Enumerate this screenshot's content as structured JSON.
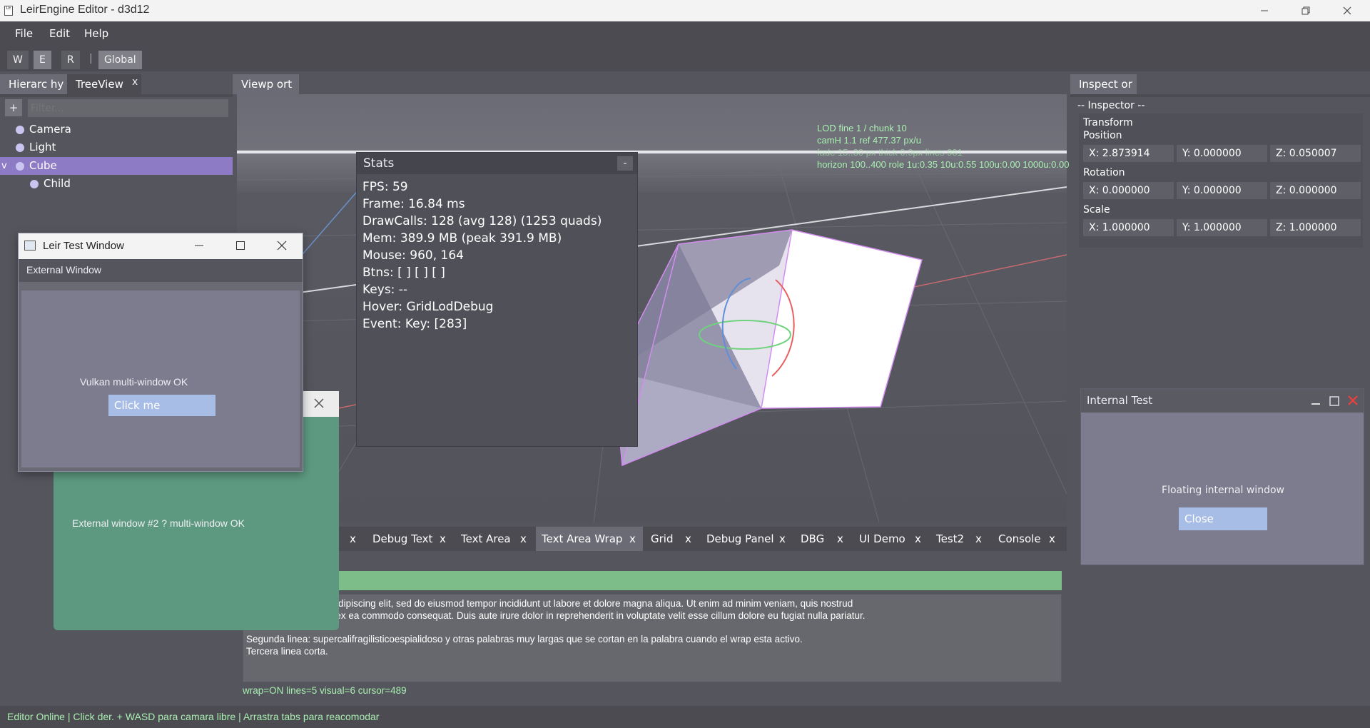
{
  "window": {
    "title": "LeirEngine Editor - d3d12",
    "app_icon": "LeirEngine app icon"
  },
  "menu": [
    "File",
    "Edit",
    "Help"
  ],
  "toolbar": {
    "w": "W",
    "e": "E",
    "r": "R",
    "sep": "|",
    "space": "Global"
  },
  "hierarchy": {
    "tabs": [
      {
        "label": "Hierarc hy"
      },
      {
        "label": "TreeView"
      }
    ],
    "close": "x",
    "add_label": "+",
    "filter_placeholder": "Filter...",
    "items": [
      {
        "label": "Camera",
        "expander": "",
        "selected": false
      },
      {
        "label": "Light",
        "expander": "",
        "selected": false
      },
      {
        "label": "Cube",
        "expander": "v",
        "selected": true
      },
      {
        "label": "Child",
        "expander": "",
        "selected": false
      }
    ]
  },
  "viewport": {
    "tab": "Viewp ort",
    "lod": [
      "LOD fine 1 / chunk 10",
      "camH 1.1  ref 477.37 px/u",
      "fade 15..30 px  thick 0.9px  lines 981",
      "horizon 100..400  role 1u:0.35 10u:0.55 100u:0.00 1000u:0.00"
    ]
  },
  "stats": {
    "title": "Stats",
    "collapse": "-",
    "lines": [
      "FPS: 59",
      "Frame: 16.84 ms",
      "DrawCalls: 128 (avg 128)  (1253 quads)",
      "Mem: 389.9 MB  (peak 391.9 MB)",
      "Mouse: 960, 164",
      "Btns: [ ] [ ] [ ]",
      "Keys: --",
      "Hover: GridLodDebug",
      "Event: Key: [283]"
    ]
  },
  "inspector": {
    "tab": "Inspect or",
    "header": "-- Inspector --",
    "transform": "Transform",
    "position": {
      "label": "Position",
      "x": "X:  2.873914",
      "y": "Y:  0.000000",
      "z": "Z:  0.050007"
    },
    "rotation": {
      "label": "Rotation",
      "x": "X:  0.000000",
      "y": "Y:  0.000000",
      "z": "Z:  0.000000"
    },
    "scale": {
      "label": "Scale",
      "x": "X:  1.000000",
      "y": "Y:  1.000000",
      "z": "Z:  1.000000"
    }
  },
  "internal_window": {
    "title": "Internal Test",
    "text": "Floating internal window",
    "button": "Close"
  },
  "bottom_tabs": [
    {
      "label": "Debug Text",
      "active": false
    },
    {
      "label": "Text Area",
      "active": false
    },
    {
      "label": "Text Area Wrap",
      "active": true
    },
    {
      "label": "Grid",
      "active": false
    },
    {
      "label": "Debug Panel",
      "active": false
    },
    {
      "label": "DBG",
      "active": false
    },
    {
      "label": "UI Demo",
      "active": false
    },
    {
      "label": "Test2",
      "active": false
    },
    {
      "label": "Console",
      "active": false
    }
  ],
  "tab_close": "x",
  "text_area": {
    "lines": [
      "it amet, consectetur adipiscing elit, sed do eiusmod tempor incididunt ut labore et dolore magna aliqua. Ut enim ad minim veniam, quis nostrud",
      "laboris nisi ut aliquip ex ea commodo consequat. Duis aute irure dolor in reprehenderit in voluptate velit esse cillum dolore eu fugiat nulla pariatur.",
      "Segunda linea: supercalifragilisticoespialidoso y otras palabras muy largas que se cortan en la palabra cuando el wrap esta activo.",
      "Tercera linea corta."
    ],
    "status": "wrap=ON lines=5 visual=6 cursor=489"
  },
  "external_window_1": {
    "title": "Leir Test Window",
    "menu": "External Window",
    "text": "Vulkan multi-window OK",
    "button": "Click me"
  },
  "external_window_2": {
    "text": "External window #2 ? multi-window OK"
  },
  "status_bar": "Editor Online | Click der. + WASD para camara libre | Arrastra tabs para reacomodar",
  "colors": {
    "accent": "#8e7bc5",
    "text_green": "#a8efb0",
    "button_blue": "#a8bde6",
    "ext2_green": "#5d9981"
  }
}
